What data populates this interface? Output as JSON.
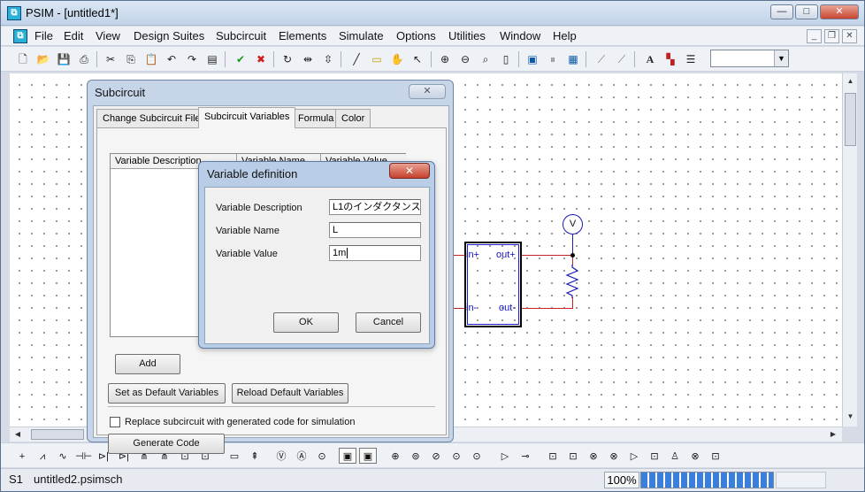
{
  "window": {
    "title": "PSIM - [untitled1*]",
    "app_icon": "psim-app-icon",
    "minimize": "—",
    "maximize": "□",
    "close": "✕"
  },
  "menubar": {
    "items": [
      "File",
      "Edit",
      "View",
      "Design Suites",
      "Subcircuit",
      "Elements",
      "Simulate",
      "Options",
      "Utilities",
      "Window",
      "Help"
    ],
    "mdi_min": "_",
    "mdi_restore": "❐",
    "mdi_close": "✕"
  },
  "toolbar": {
    "icons": [
      "new-icon",
      "open-icon",
      "save-icon",
      "print-icon",
      "cut-icon",
      "copy-icon",
      "paste-icon",
      "undo-icon",
      "redo-icon",
      "clipboard-icon",
      "check-icon",
      "cross-icon",
      "rotate-icon",
      "flip-lr-icon",
      "flip-tb-icon",
      "wire-icon",
      "label-icon",
      "pan-icon",
      "select-icon",
      "zoom-in-icon",
      "zoom-out-icon",
      "zoom-fit-icon",
      "page-icon",
      "run-icon",
      "pause-icon",
      "simview-icon",
      "probe-icon",
      "probe2-icon",
      "text-icon",
      "color-icon",
      "list-icon"
    ],
    "combo_value": ""
  },
  "subcircuit_dialog": {
    "title": "Subcircuit",
    "close": "✕",
    "tabs": [
      "Change Subcircuit File",
      "Subcircuit Variables",
      "Formula",
      "Color"
    ],
    "active_tab": "Subcircuit Variables",
    "columns": [
      "Variable Description",
      "Variable Name",
      "Variable Value"
    ],
    "add_label": "Add",
    "set_default_label": "Set as Default Variables",
    "reload_default_label": "Reload Default Variables",
    "replace_label": "Replace subcircuit with generated code for simulation",
    "generate_label": "Generate Code"
  },
  "variable_dialog": {
    "title": "Variable definition",
    "close": "✕",
    "description_label": "Variable Description",
    "description_value": "L1のインダクタンス",
    "name_label": "Variable Name",
    "name_value": "L",
    "value_label": "Variable Value",
    "value_value": "1m",
    "ok_label": "OK",
    "cancel_label": "Cancel"
  },
  "schematic": {
    "pins": [
      "in+",
      "out+",
      "in-",
      "out-"
    ],
    "voltmeter": "V"
  },
  "statusbar": {
    "page": "S1",
    "file": "untitled2.psimsch",
    "zoom": "100%",
    "progress_percent": 100
  }
}
